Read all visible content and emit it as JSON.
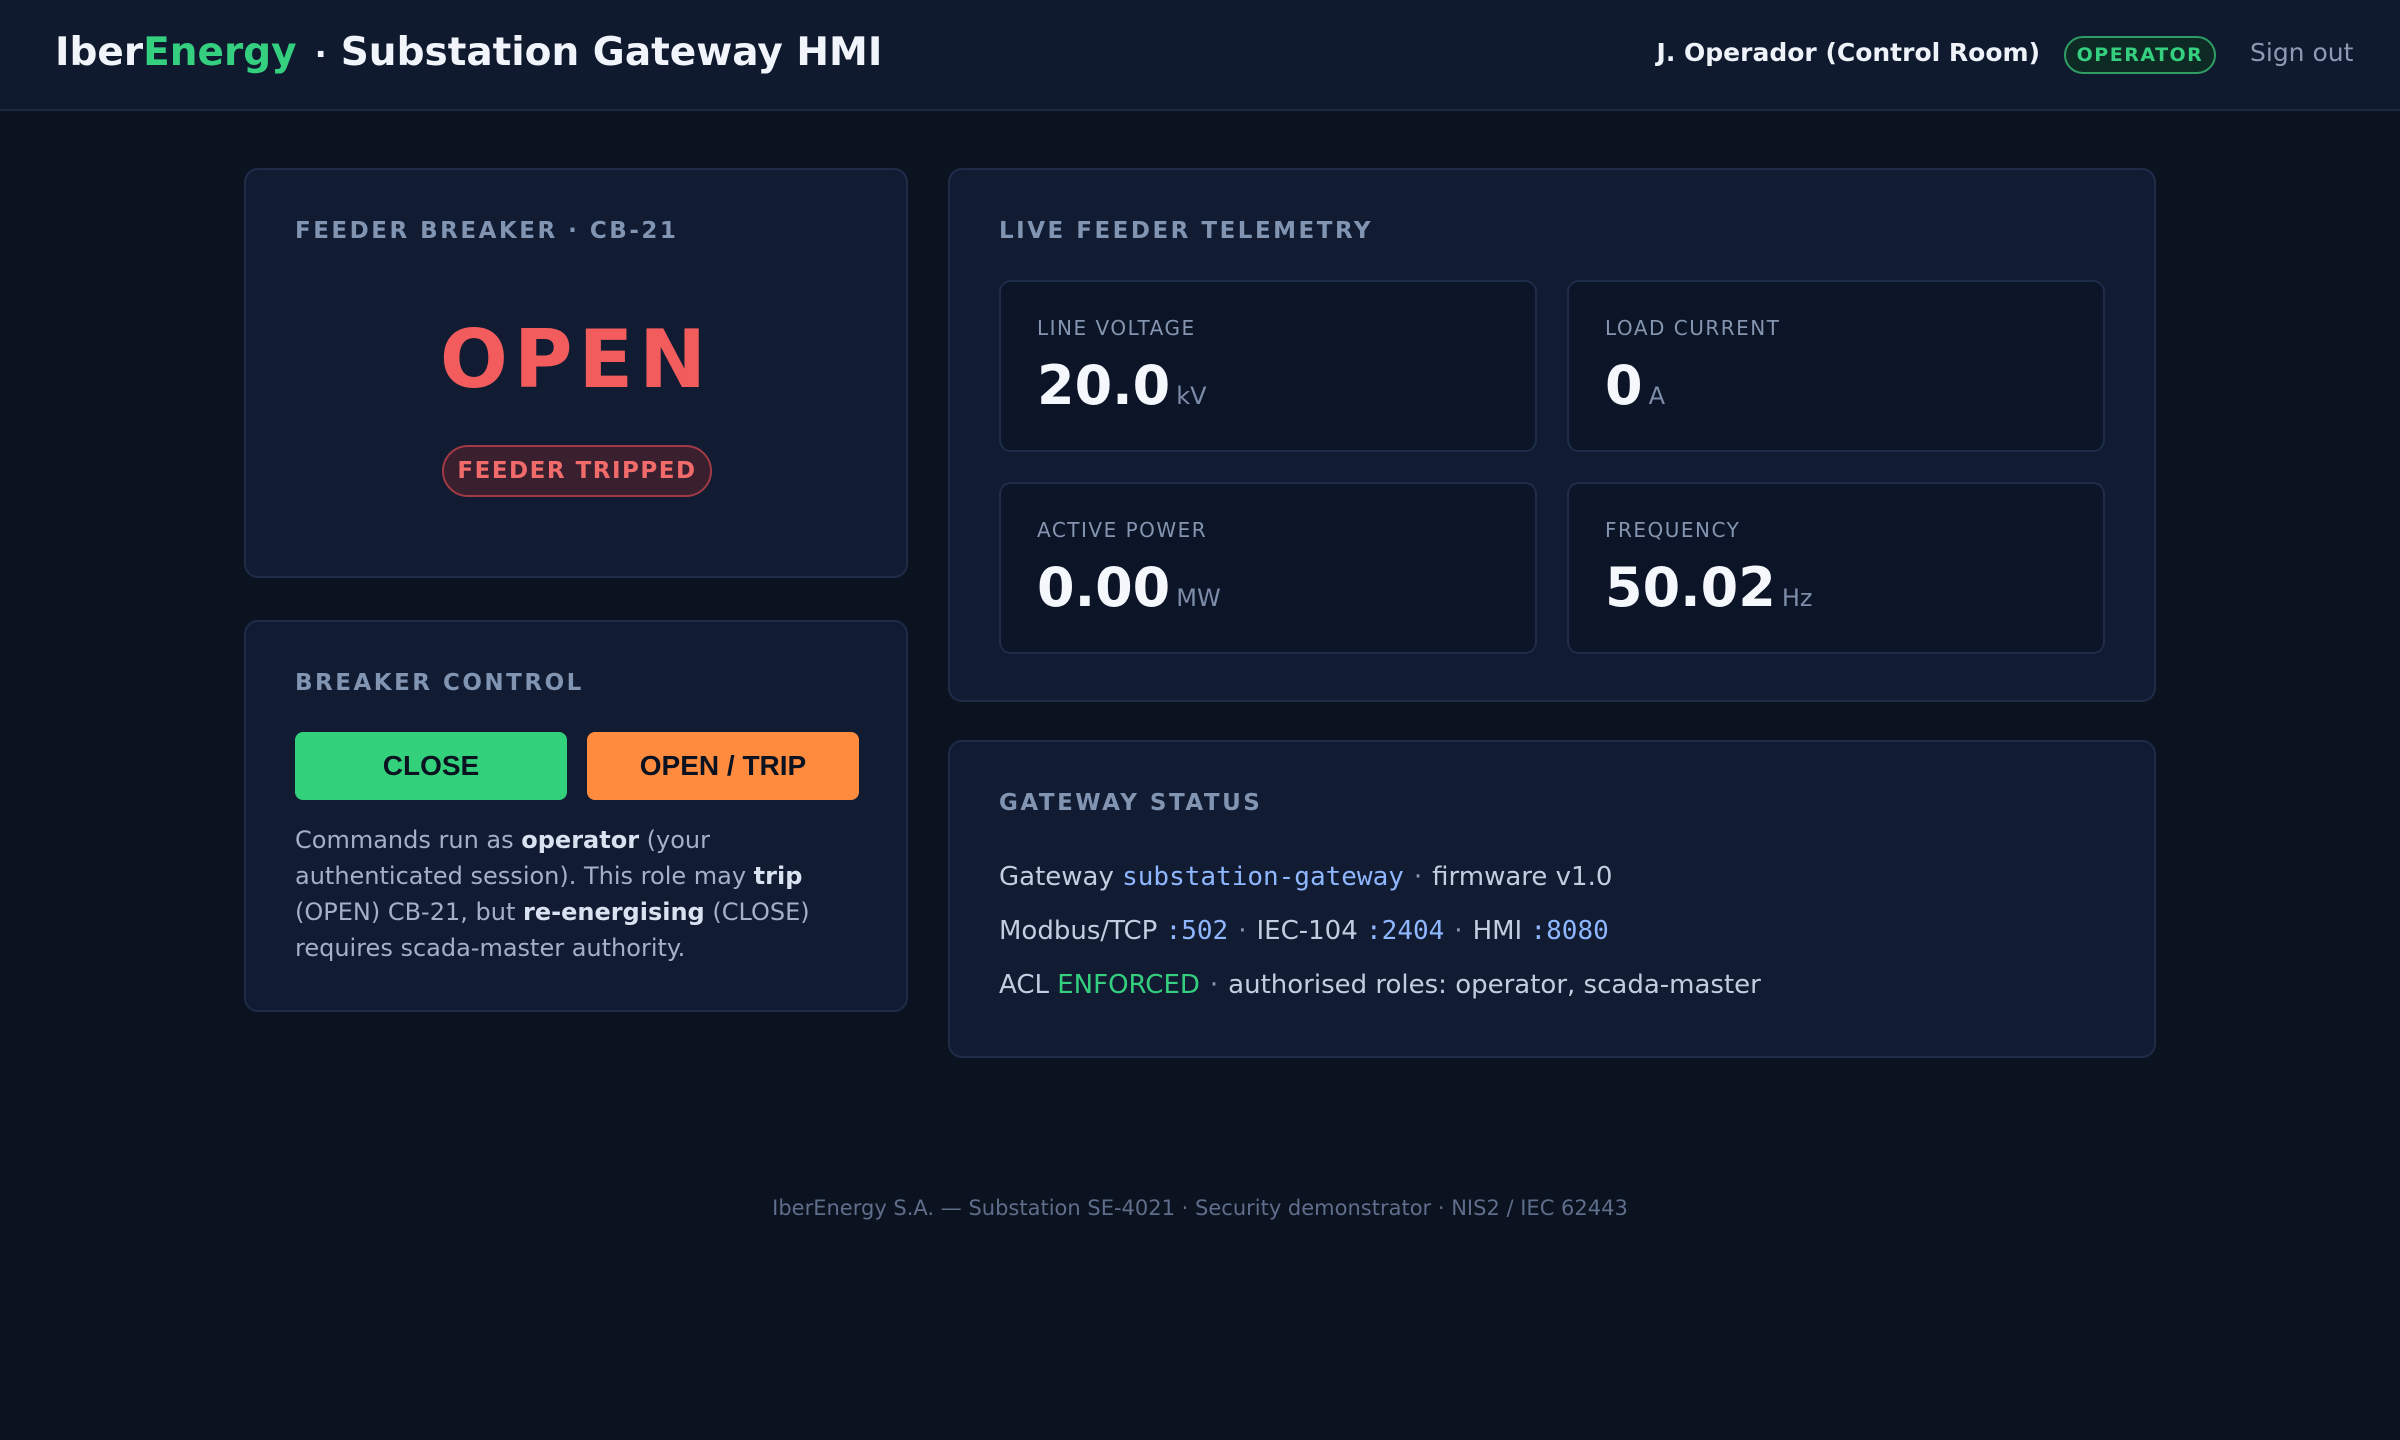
{
  "header": {
    "brand_part1": "Iber",
    "brand_part2": "Energy",
    "separator": "·",
    "app_title": "Substation Gateway HMI",
    "user": "J. Operador (Control Room)",
    "role_badge": "OPERATOR",
    "signout": "Sign out"
  },
  "breaker": {
    "title": "FEEDER BREAKER · CB-21",
    "state": "OPEN",
    "status_badge": "FEEDER TRIPPED"
  },
  "control": {
    "title": "BREAKER CONTROL",
    "close_label": "CLOSE",
    "trip_label": "OPEN / TRIP",
    "note": {
      "t1": "Commands run as ",
      "b1": "operator",
      "t2": " (your authenticated session). This role may ",
      "b2": "trip",
      "t3": " (OPEN) CB-21, but ",
      "b3": "re-energising",
      "t4": " (CLOSE) requires scada-master authority."
    }
  },
  "telemetry": {
    "title": "LIVE FEEDER TELEMETRY",
    "voltage": {
      "label": "LINE VOLTAGE",
      "value": "20.0",
      "unit": "kV"
    },
    "current": {
      "label": "LOAD CURRENT",
      "value": "0",
      "unit": "A"
    },
    "power": {
      "label": "ACTIVE POWER",
      "value": "0.00",
      "unit": "MW"
    },
    "frequency": {
      "label": "FREQUENCY",
      "value": "50.02",
      "unit": "Hz"
    }
  },
  "gateway": {
    "title": "GATEWAY STATUS",
    "line1": {
      "label": "Gateway",
      "host": "substation-gateway",
      "sep": "·",
      "firmware": "firmware v1.0"
    },
    "line2": {
      "modbus_label": "Modbus/TCP",
      "modbus_port": ":502",
      "sep": "·",
      "iec_label": "IEC-104",
      "iec_port": ":2404",
      "hmi_label": "HMI",
      "hmi_port": ":8080"
    },
    "line3": {
      "label": "ACL",
      "status": "ENFORCED",
      "sep": "·",
      "roles": "authorised roles: operator, scada-master"
    }
  },
  "footer": "IberEnergy S.A. — Substation SE-4021 · Security demonstrator · NIS2 / IEC 62443",
  "colors": {
    "background": "#0b1220",
    "card": "#111c33",
    "accent_green": "#34d07f",
    "alert_red": "#f25c5c",
    "trip_orange": "#ff8c3e",
    "mono_blue": "#8fb7ff"
  }
}
